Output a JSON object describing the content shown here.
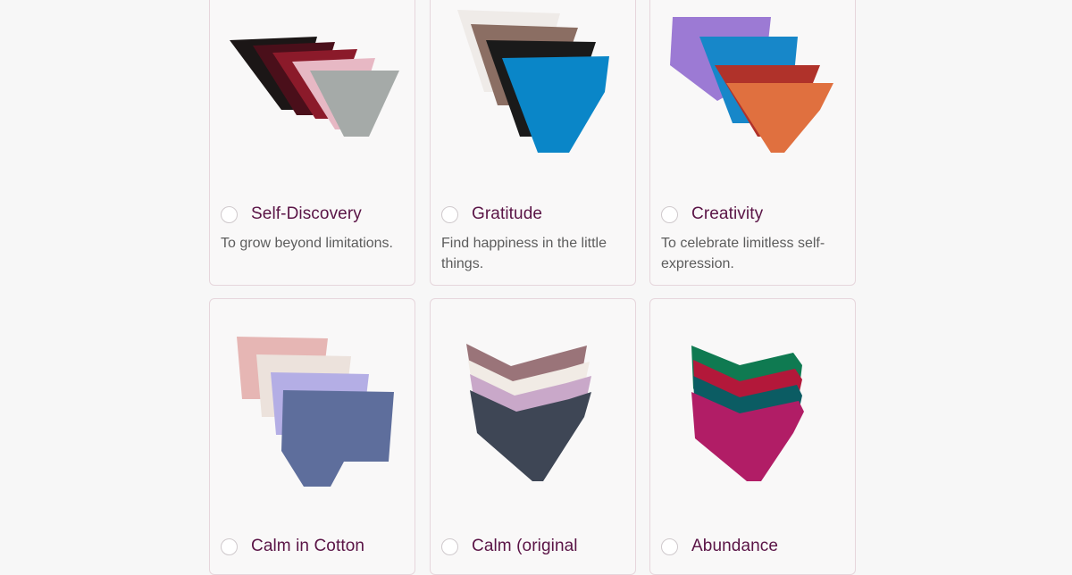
{
  "products": [
    {
      "title": "Self-Discovery",
      "description": "To grow beyond limitations."
    },
    {
      "title": "Gratitude",
      "description": "Find happiness in the little things."
    },
    {
      "title": "Creativity",
      "description": "To celebrate limitless self-expression."
    },
    {
      "title": "Calm in Cotton",
      "description": ""
    },
    {
      "title": "Calm (original",
      "description": ""
    },
    {
      "title": "Abundance",
      "description": ""
    }
  ],
  "colors": {
    "title": "#5a1446",
    "description": "#5c5c5c",
    "card_border": "#e6d6dc",
    "page_bg": "#f7f7f7"
  }
}
